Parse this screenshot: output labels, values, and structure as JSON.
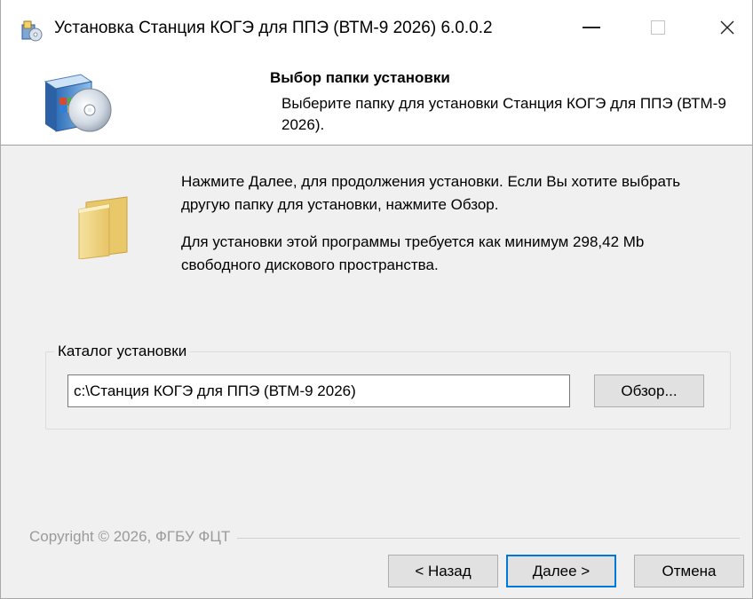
{
  "window": {
    "title": "Установка Станция КОГЭ для ППЭ (ВТМ-9 2026) 6.0.0.2",
    "minimize_glyph": "—",
    "close_glyph": "✕"
  },
  "header": {
    "title": "Выбор папки установки",
    "description": "Выберите папку для установки Станция КОГЭ для ППЭ (ВТМ-9 2026)."
  },
  "content": {
    "message_next": "Нажмите Далее, для продолжения установки. Если Вы хотите выбрать другую папку для установки, нажмите Обзор.",
    "message_space": "Для установки этой программы требуется как минимум 298,42 Mb свободного дискового пространства."
  },
  "install_dir": {
    "legend": "Каталог установки",
    "path_value": "c:\\Станция КОГЭ для ППЭ (ВТМ-9 2026)",
    "browse_label": "Обзор..."
  },
  "footer": {
    "copyright": "Copyright © 2026, ФГБУ ФЦТ",
    "back_label": "< Назад",
    "next_label": "Далее >",
    "cancel_label": "Отмена"
  },
  "icons": {
    "app": "installer-icon",
    "header": "setup-box-cd-icon",
    "folder": "folder-icon"
  },
  "colors": {
    "focus_border": "#0078d7",
    "dialog_bg": "#f0f0f0",
    "header_bg": "#ffffff"
  }
}
